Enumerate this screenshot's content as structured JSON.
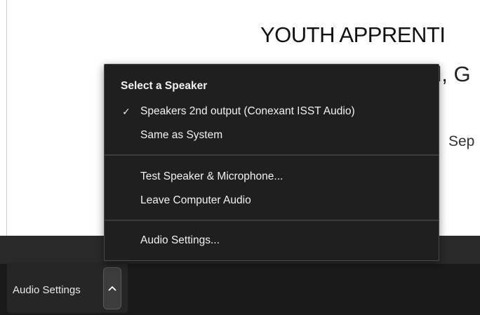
{
  "slide": {
    "title": "YOUTH APPRENTI",
    "subtitle": "d, G",
    "line3": "Sep"
  },
  "menu": {
    "heading": "Select a Speaker",
    "items": [
      {
        "label": "Speakers 2nd output (Conexant ISST Audio)",
        "checked": true,
        "check_glyph": "✓"
      },
      {
        "label": "Same as System",
        "checked": false
      },
      {
        "label": "Test Speaker & Microphone...",
        "checked": false
      },
      {
        "label": "Leave Computer Audio",
        "checked": false
      },
      {
        "label": "Audio Settings...",
        "checked": false
      }
    ]
  },
  "toolbar": {
    "audio_label": "Audio Settings",
    "caret_icon": "chevron-up-icon"
  },
  "colors": {
    "menu_bg": "#1f1f1f",
    "toolbar_bg": "#1a1a1a",
    "menu_text": "#f2f2f2"
  }
}
